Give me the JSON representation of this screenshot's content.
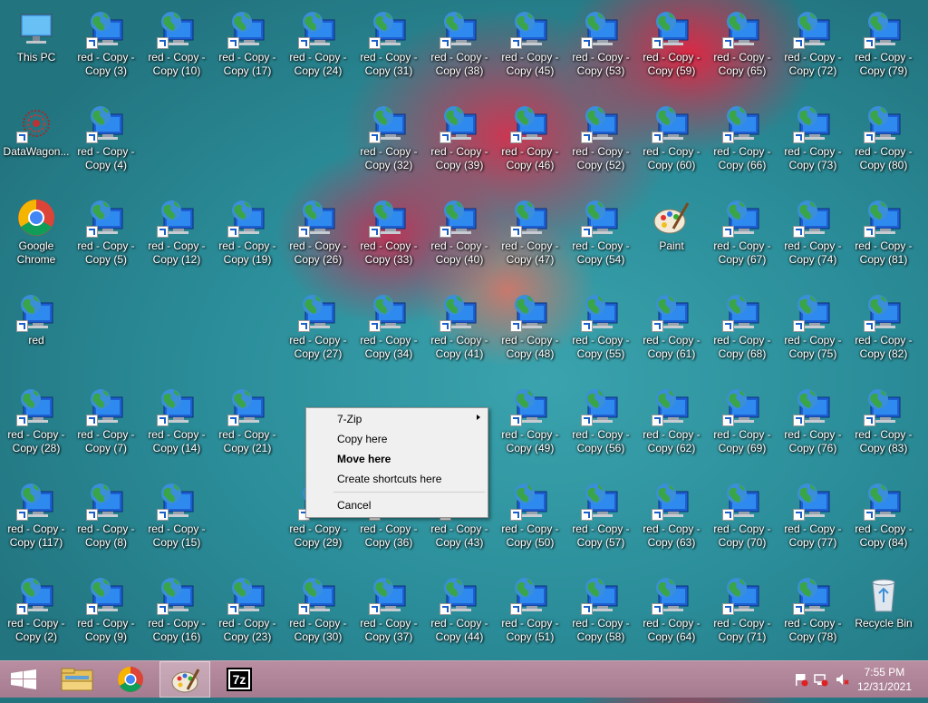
{
  "desktop": {
    "icons": [
      {
        "label": "This PC",
        "kind": "pc",
        "col": 0,
        "row": 0
      },
      {
        "label": "DataWagon...",
        "kind": "datawagon",
        "col": 0,
        "row": 1
      },
      {
        "label": "Google Chrome",
        "kind": "chrome",
        "col": 0,
        "row": 2
      },
      {
        "label": "red",
        "kind": "globe",
        "col": 0,
        "row": 3
      },
      {
        "label": "red - Copy - Copy (28)",
        "kind": "globe",
        "col": 0,
        "row": 4
      },
      {
        "label": "red - Copy - Copy (117)",
        "kind": "globe",
        "col": 0,
        "row": 5
      },
      {
        "label": "red - Copy - Copy (2)",
        "kind": "globe",
        "col": 0,
        "row": 6
      },
      {
        "label": "red - Copy - Copy (3)",
        "kind": "globe",
        "col": 1,
        "row": 0
      },
      {
        "label": "red - Copy - Copy (4)",
        "kind": "globe",
        "col": 1,
        "row": 1
      },
      {
        "label": "red - Copy - Copy (5)",
        "kind": "globe",
        "col": 1,
        "row": 2
      },
      {
        "label": "red - Copy - Copy (7)",
        "kind": "globe",
        "col": 1,
        "row": 4
      },
      {
        "label": "red - Copy - Copy (8)",
        "kind": "globe",
        "col": 1,
        "row": 5
      },
      {
        "label": "red - Copy - Copy (9)",
        "kind": "globe",
        "col": 1,
        "row": 6
      },
      {
        "label": "red - Copy - Copy (10)",
        "kind": "globe",
        "col": 2,
        "row": 0
      },
      {
        "label": "red - Copy - Copy (12)",
        "kind": "globe",
        "col": 2,
        "row": 2
      },
      {
        "label": "red - Copy - Copy (14)",
        "kind": "globe",
        "col": 2,
        "row": 4
      },
      {
        "label": "red - Copy - Copy (15)",
        "kind": "globe",
        "col": 2,
        "row": 5
      },
      {
        "label": "red - Copy - Copy (16)",
        "kind": "globe",
        "col": 2,
        "row": 6
      },
      {
        "label": "red - Copy - Copy (17)",
        "kind": "globe",
        "col": 3,
        "row": 0
      },
      {
        "label": "red - Copy - Copy (19)",
        "kind": "globe",
        "col": 3,
        "row": 2
      },
      {
        "label": "red - Copy - Copy (21)",
        "kind": "globe",
        "col": 3,
        "row": 4
      },
      {
        "label": "red - Copy - Copy (23)",
        "kind": "globe",
        "col": 3,
        "row": 6
      },
      {
        "label": "red - Copy - Copy (24)",
        "kind": "globe",
        "col": 4,
        "row": 0
      },
      {
        "label": "red - Copy - Copy (26)",
        "kind": "globe",
        "col": 4,
        "row": 2
      },
      {
        "label": "red - Copy - Copy (27)",
        "kind": "globe",
        "col": 4,
        "row": 3
      },
      {
        "label": "red - Copy - Copy (29)",
        "kind": "globe",
        "col": 4,
        "row": 5
      },
      {
        "label": "red - Copy - Copy (30)",
        "kind": "globe",
        "col": 4,
        "row": 6
      },
      {
        "label": "red - Copy - Copy (31)",
        "kind": "globe",
        "col": 5,
        "row": 0
      },
      {
        "label": "red - Copy - Copy (32)",
        "kind": "globe",
        "col": 5,
        "row": 1
      },
      {
        "label": "red - Copy - Copy (33)",
        "kind": "globe",
        "col": 5,
        "row": 2
      },
      {
        "label": "red - Copy - Copy (34)",
        "kind": "globe",
        "col": 5,
        "row": 3
      },
      {
        "label": "red - Copy - Copy (36)",
        "kind": "globe",
        "col": 5,
        "row": 5
      },
      {
        "label": "red - Copy - Copy (37)",
        "kind": "globe",
        "col": 5,
        "row": 6
      },
      {
        "label": "red - Copy - Copy (38)",
        "kind": "globe",
        "col": 6,
        "row": 0
      },
      {
        "label": "red - Copy - Copy (39)",
        "kind": "globe",
        "col": 6,
        "row": 1
      },
      {
        "label": "red - Copy - Copy (40)",
        "kind": "globe",
        "col": 6,
        "row": 2
      },
      {
        "label": "red - Copy - Copy (41)",
        "kind": "globe",
        "col": 6,
        "row": 3
      },
      {
        "label": "red - Copy - Copy (43)",
        "kind": "globe",
        "col": 6,
        "row": 5
      },
      {
        "label": "red - Copy - Copy (44)",
        "kind": "globe",
        "col": 6,
        "row": 6
      },
      {
        "label": "red - Copy - Copy (45)",
        "kind": "globe",
        "col": 7,
        "row": 0
      },
      {
        "label": "red - Copy - Copy (46)",
        "kind": "globe",
        "col": 7,
        "row": 1
      },
      {
        "label": "red - Copy - Copy (47)",
        "kind": "globe",
        "col": 7,
        "row": 2
      },
      {
        "label": "red - Copy - Copy (48)",
        "kind": "globe",
        "col": 7,
        "row": 3
      },
      {
        "label": "red - Copy - Copy (49)",
        "kind": "globe",
        "col": 7,
        "row": 4
      },
      {
        "label": "red - Copy - Copy (50)",
        "kind": "globe",
        "col": 7,
        "row": 5
      },
      {
        "label": "red - Copy - Copy (51)",
        "kind": "globe",
        "col": 7,
        "row": 6
      },
      {
        "label": "red - Copy - Copy (53)",
        "kind": "globe",
        "col": 8,
        "row": 0
      },
      {
        "label": "red - Copy - Copy (52)",
        "kind": "globe",
        "col": 8,
        "row": 1
      },
      {
        "label": "red - Copy - Copy (54)",
        "kind": "globe",
        "col": 8,
        "row": 2
      },
      {
        "label": "red - Copy - Copy (55)",
        "kind": "globe",
        "col": 8,
        "row": 3
      },
      {
        "label": "red - Copy - Copy (56)",
        "kind": "globe",
        "col": 8,
        "row": 4
      },
      {
        "label": "red - Copy - Copy (57)",
        "kind": "globe",
        "col": 8,
        "row": 5
      },
      {
        "label": "red - Copy - Copy (58)",
        "kind": "globe",
        "col": 8,
        "row": 6
      },
      {
        "label": "red - Copy - Copy (59)",
        "kind": "globe",
        "col": 9,
        "row": 0
      },
      {
        "label": "red - Copy - Copy (60)",
        "kind": "globe",
        "col": 9,
        "row": 1
      },
      {
        "label": "Paint",
        "kind": "paint",
        "col": 9,
        "row": 2
      },
      {
        "label": "red - Copy - Copy (61)",
        "kind": "globe",
        "col": 9,
        "row": 3
      },
      {
        "label": "red - Copy - Copy (62)",
        "kind": "globe",
        "col": 9,
        "row": 4
      },
      {
        "label": "red - Copy - Copy (63)",
        "kind": "globe",
        "col": 9,
        "row": 5
      },
      {
        "label": "red - Copy - Copy (64)",
        "kind": "globe",
        "col": 9,
        "row": 6
      },
      {
        "label": "red - Copy - Copy (65)",
        "kind": "globe",
        "col": 10,
        "row": 0
      },
      {
        "label": "red - Copy - Copy (66)",
        "kind": "globe",
        "col": 10,
        "row": 1
      },
      {
        "label": "red - Copy - Copy (67)",
        "kind": "globe",
        "col": 10,
        "row": 2
      },
      {
        "label": "red - Copy - Copy (68)",
        "kind": "globe",
        "col": 10,
        "row": 3
      },
      {
        "label": "red - Copy - Copy (69)",
        "kind": "globe",
        "col": 10,
        "row": 4
      },
      {
        "label": "red - Copy - Copy (70)",
        "kind": "globe",
        "col": 10,
        "row": 5
      },
      {
        "label": "red - Copy - Copy (71)",
        "kind": "globe",
        "col": 10,
        "row": 6
      },
      {
        "label": "red - Copy - Copy (72)",
        "kind": "globe",
        "col": 11,
        "row": 0
      },
      {
        "label": "red - Copy - Copy (73)",
        "kind": "globe",
        "col": 11,
        "row": 1
      },
      {
        "label": "red - Copy - Copy (74)",
        "kind": "globe",
        "col": 11,
        "row": 2
      },
      {
        "label": "red - Copy - Copy (75)",
        "kind": "globe",
        "col": 11,
        "row": 3
      },
      {
        "label": "red - Copy - Copy (76)",
        "kind": "globe",
        "col": 11,
        "row": 4
      },
      {
        "label": "red - Copy - Copy (77)",
        "kind": "globe",
        "col": 11,
        "row": 5
      },
      {
        "label": "red - Copy - Copy (78)",
        "kind": "globe",
        "col": 11,
        "row": 6
      },
      {
        "label": "red - Copy - Copy (79)",
        "kind": "globe",
        "col": 12,
        "row": 0
      },
      {
        "label": "red - Copy - Copy (80)",
        "kind": "globe",
        "col": 12,
        "row": 1
      },
      {
        "label": "red - Copy - Copy (81)",
        "kind": "globe",
        "col": 12,
        "row": 2
      },
      {
        "label": "red - Copy - Copy (82)",
        "kind": "globe",
        "col": 12,
        "row": 3
      },
      {
        "label": "red - Copy - Copy (83)",
        "kind": "globe",
        "col": 12,
        "row": 4
      },
      {
        "label": "red - Copy - Copy (84)",
        "kind": "globe",
        "col": 12,
        "row": 5
      },
      {
        "label": "Recycle Bin",
        "kind": "recycle",
        "col": 12,
        "row": 6
      }
    ]
  },
  "context_menu": {
    "items": [
      {
        "label": "7-Zip",
        "submenu": true,
        "bold": false
      },
      {
        "label": "Copy here",
        "submenu": false,
        "bold": false
      },
      {
        "label": "Move here",
        "submenu": false,
        "bold": true
      },
      {
        "label": "Create shortcuts here",
        "submenu": false,
        "bold": false
      },
      {
        "label": "Cancel",
        "submenu": false,
        "bold": false
      }
    ]
  },
  "taskbar": {
    "buttons": [
      {
        "name": "start-button",
        "icon": "windows-logo-icon"
      },
      {
        "name": "file-explorer-button",
        "icon": "folder-icon"
      },
      {
        "name": "chrome-button",
        "icon": "chrome-icon"
      },
      {
        "name": "paint-button",
        "icon": "paint-icon",
        "active": true
      },
      {
        "name": "seven-zip-button",
        "icon": "seven-zip-icon",
        "text": "7z"
      }
    ],
    "tray": {
      "icons": [
        "flag-icon",
        "network-icon",
        "speaker-muted-icon"
      ],
      "time": "7:55 PM",
      "date": "12/31/2021"
    }
  },
  "colors": {
    "taskbar": "#a97f94",
    "menu_bg": "#f0f0f0",
    "desktop": "#2a8c98"
  }
}
